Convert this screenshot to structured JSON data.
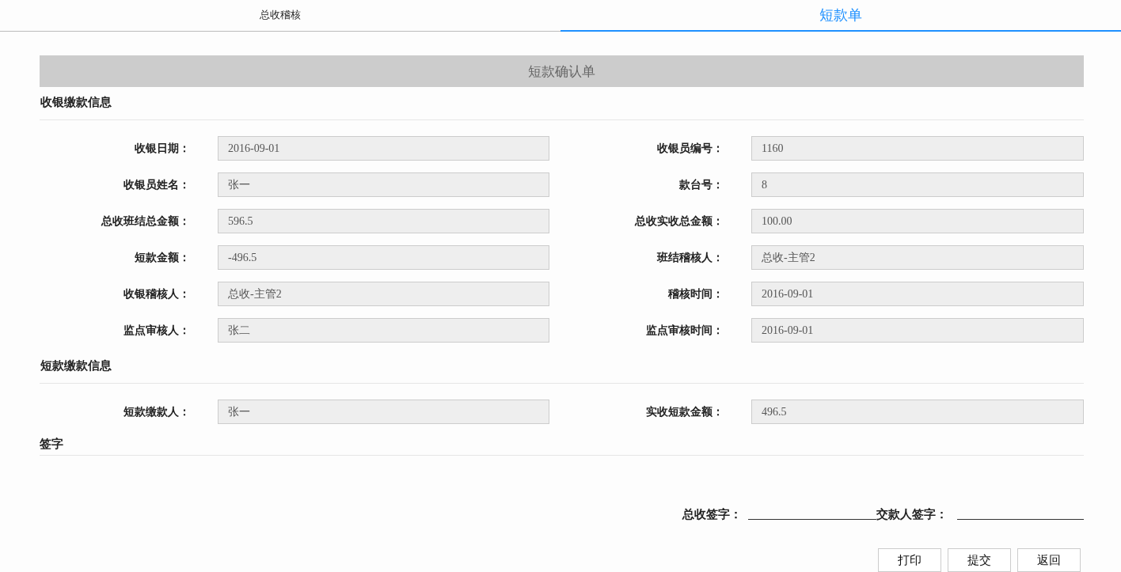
{
  "tabs": [
    {
      "label": "总收稽核",
      "selected": false
    },
    {
      "label": "短款单",
      "selected": true
    }
  ],
  "form_title": "短款确认单",
  "sections": [
    {
      "heading": "收银缴款信息",
      "fields": [
        {
          "label": "收银日期：",
          "value": "2016-09-01"
        },
        {
          "label": "收银员编号：",
          "value": "1160"
        },
        {
          "label": "收银员姓名：",
          "value": "张一"
        },
        {
          "label": "款台号：",
          "value": "8"
        },
        {
          "label": "总收班结总金额：",
          "value": "596.5"
        },
        {
          "label": "总收实收总金额：",
          "value": "100.00"
        },
        {
          "label": "短款金额：",
          "value": "-496.5"
        },
        {
          "label": "班结稽核人：",
          "value": "总收-主管2"
        },
        {
          "label": "收银稽核人：",
          "value": "总收-主管2"
        },
        {
          "label": "稽核时间：",
          "value": "2016-09-01"
        },
        {
          "label": "监点审核人：",
          "value": "张二"
        },
        {
          "label": "监点审核时间：",
          "value": "2016-09-01"
        }
      ]
    },
    {
      "heading": "短款缴款信息",
      "fields": [
        {
          "label": "短款缴款人：",
          "value": "张一"
        },
        {
          "label": "实收短款金额：",
          "value": "496.5"
        }
      ]
    }
  ],
  "signature": {
    "heading": "签字",
    "lines": [
      "总收签字：",
      "交款人签字："
    ]
  },
  "buttons": [
    "打印",
    "提交",
    "返回"
  ]
}
